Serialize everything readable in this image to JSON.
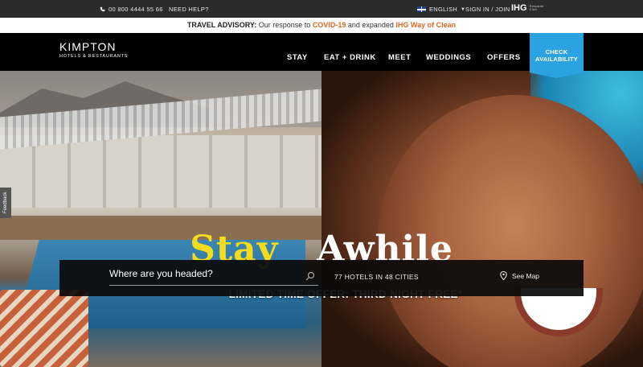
{
  "utility": {
    "phone": "00 800 4444 55 66",
    "help": "NEED HELP?",
    "language": "ENGLISH",
    "sign_in": "SIGN IN / JOIN",
    "ihg_mark": "IHG",
    "ihg_sub": "Rewards Club"
  },
  "advisory": {
    "label": "TRAVEL ADVISORY:",
    "text1": "Our response to",
    "link1": "COVID-19",
    "text2": "and expanded",
    "link2": "IHG Way of Clean"
  },
  "header": {
    "logo_main": "KIMPTON",
    "logo_sub": "HOTELS & RESTAURANTS",
    "nav": [
      "STAY",
      "EAT + DRINK",
      "MEET",
      "WEDDINGS",
      "OFFERS"
    ],
    "cta": "CHECK AVAILABILITY"
  },
  "hero": {
    "headline_left": "Stay",
    "headline_right": "Awhile",
    "offer": "LIMITED TIME OFFER: THIRD NIGHT FREE*"
  },
  "search": {
    "placeholder": "Where are you headed?",
    "count": "77 HOTELS IN 48 CITIES",
    "map": "See Map"
  },
  "feedback": "Feedback",
  "colors": {
    "accent": "#e06a23",
    "cta": "#2aa3e0",
    "headline_yellow": "#f4dc1b"
  }
}
